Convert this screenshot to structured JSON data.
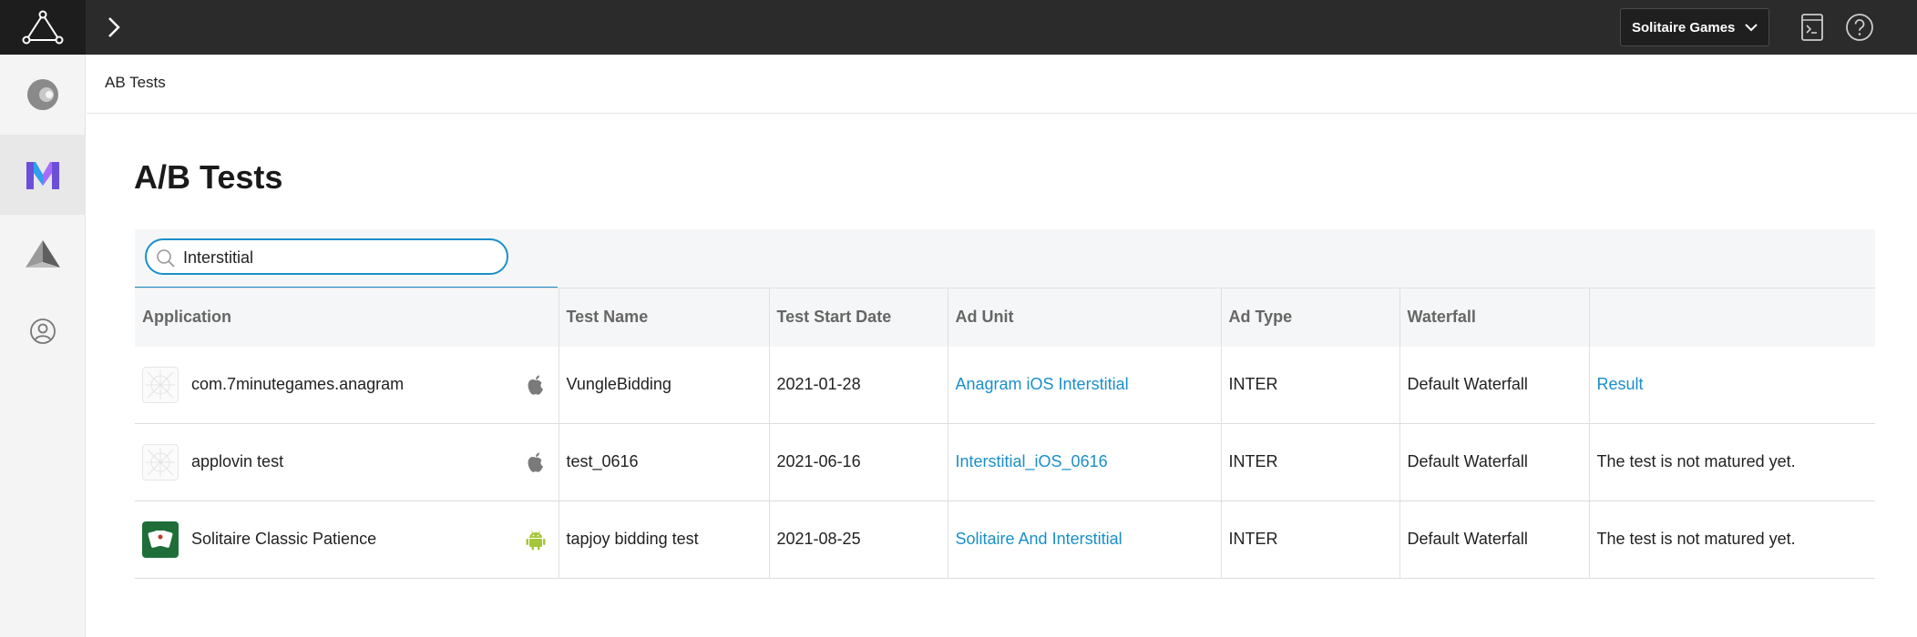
{
  "header": {
    "app_selector": {
      "selected": "Solitaire Games"
    }
  },
  "breadcrumb": "AB Tests",
  "page_title": "A/B Tests",
  "search": {
    "value": "Interstitial",
    "placeholder": ""
  },
  "table": {
    "columns": [
      "Application",
      "Test Name",
      "Test Start Date",
      "Ad Unit",
      "Ad Type",
      "Waterfall",
      ""
    ],
    "rows": [
      {
        "application": "com.7minutegames.anagram",
        "platform": "apple-icon",
        "test_name": "VungleBidding",
        "start_date": "2021-01-28",
        "ad_unit": "Anagram iOS Interstitial",
        "ad_type": "INTER",
        "waterfall": "Default Waterfall",
        "result": "Result",
        "result_is_link": true
      },
      {
        "application": "applovin test",
        "platform": "apple-icon",
        "test_name": "test_0616",
        "start_date": "2021-06-16",
        "ad_unit": "Interstitial_iOS_0616",
        "ad_type": "INTER",
        "waterfall": "Default Waterfall",
        "result": "The test is not matured yet.",
        "result_is_link": false
      },
      {
        "application": "Solitaire Classic Patience",
        "platform": "android-icon",
        "test_name": "tapjoy bidding test",
        "start_date": "2021-08-25",
        "ad_unit": "Solitaire And Interstitial",
        "ad_type": "INTER",
        "waterfall": "Default Waterfall",
        "result": "The test is not matured yet.",
        "result_is_link": false
      }
    ]
  },
  "colors": {
    "accent": "#1a8fc9",
    "topbar": "#2b2b2b",
    "android_green": "#a4c639"
  }
}
